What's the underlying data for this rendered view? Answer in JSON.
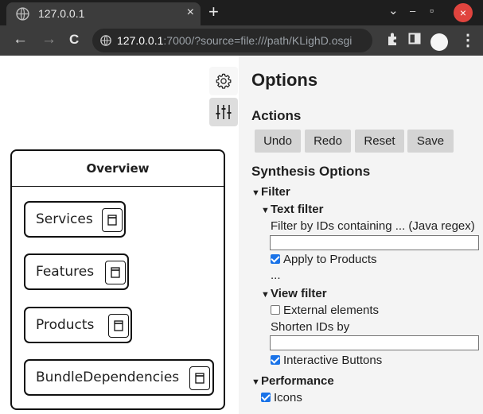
{
  "browser": {
    "tab_title": "127.0.0.1",
    "tab_close": "×",
    "new_tab": "+",
    "controls": {
      "dropdown": "⌄",
      "minimize": "–",
      "restore": "▫",
      "close": "×"
    },
    "url_host": "127.0.0.1",
    "url_rest": ":7000/?source=file:///path/KLighD.osgi",
    "nav": {
      "back": "←",
      "forward": "→",
      "reload": "C"
    },
    "kebab": "⋮"
  },
  "diagram": {
    "overview_title": "Overview",
    "nodes": [
      {
        "label": "Services"
      },
      {
        "label": "Features"
      },
      {
        "label": "Products"
      },
      {
        "label": "BundleDependencies"
      }
    ]
  },
  "options": {
    "title": "Options",
    "actions_heading": "Actions",
    "actions": [
      "Undo",
      "Redo",
      "Reset",
      "Save"
    ],
    "synthesis_heading": "Synthesis Options",
    "filter": {
      "label": "Filter",
      "text_filter": {
        "label": "Text filter",
        "input_label": "Filter by IDs containing ... (Java regex)",
        "input_value": "",
        "apply_products": {
          "label": "Apply to Products",
          "checked": true
        },
        "ellipsis": "..."
      },
      "view_filter": {
        "label": "View filter",
        "external": {
          "label": "External elements",
          "checked": false
        },
        "shorten_label": "Shorten IDs by",
        "shorten_value": "",
        "interactive": {
          "label": "Interactive Buttons",
          "checked": true
        }
      }
    },
    "performance": {
      "label": "Performance",
      "icons": {
        "label": "Icons",
        "checked": true
      }
    },
    "expand_marker": "▼"
  },
  "colors": {
    "chrome_dark": "#1e1e1e",
    "toolbar": "#3c3c3c",
    "accent_checkbox": "#1a73e8",
    "close_red": "#e0443e"
  }
}
